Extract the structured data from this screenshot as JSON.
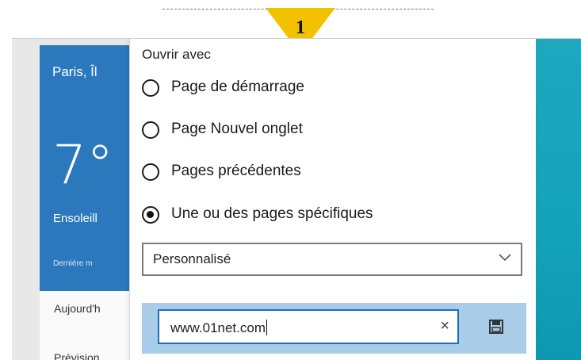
{
  "marker": {
    "label": "1",
    "color": "#f2c200"
  },
  "weather": {
    "city": "Paris, Îl",
    "temperature": "7°",
    "condition": "Ensoleill",
    "updated": "Dernière m",
    "list": [
      "Aujourd'h",
      "Prévision"
    ],
    "background": "#2c78bd"
  },
  "settings": {
    "open_with_label": "Ouvrir avec",
    "options": [
      {
        "label": "Page de démarrage",
        "selected": false
      },
      {
        "label": "Page Nouvel onglet",
        "selected": false
      },
      {
        "label": "Pages précédentes",
        "selected": false
      },
      {
        "label": "Une ou des pages spécifiques",
        "selected": true
      }
    ],
    "dropdown": {
      "selected": "Personnalisé",
      "icon": "chevron-down-icon"
    },
    "url_input": {
      "value": "www.01net.com",
      "clear_icon": "close-icon",
      "save_icon": "save-icon"
    },
    "accent": "#1f6fb5"
  }
}
